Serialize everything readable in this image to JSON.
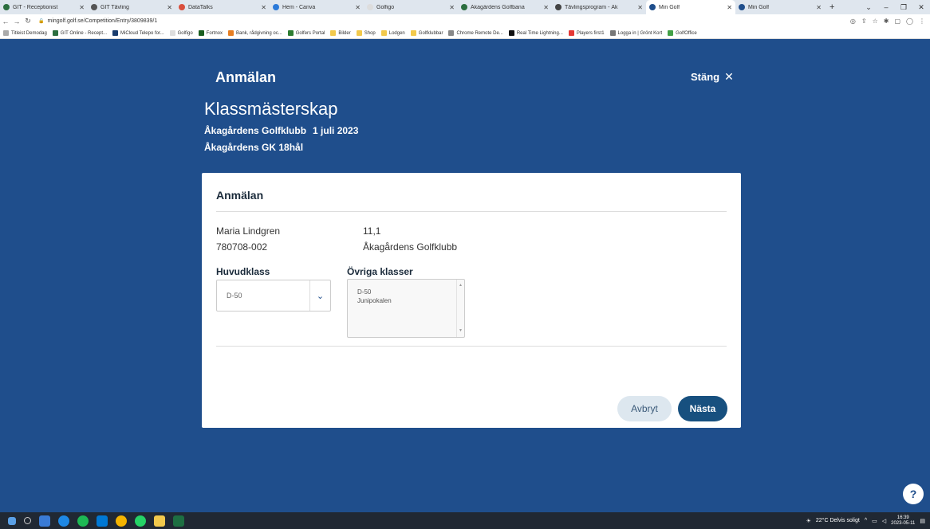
{
  "browser": {
    "tabs": [
      {
        "title": "GIT - Receptionist",
        "color": "#2c6e3f"
      },
      {
        "title": "GIT Tävling",
        "color": "#555555"
      },
      {
        "title": "DataTalks",
        "color": "#d94f3d"
      },
      {
        "title": "Hem - Canva",
        "color": "#2b7ad9"
      },
      {
        "title": "Golfigo",
        "color": "#dddddd"
      },
      {
        "title": "Åkagårdens Golfbana",
        "color": "#2c6e3f"
      },
      {
        "title": "Tävlingsprogram - Åk",
        "color": "#444444"
      },
      {
        "title": "Min Golf",
        "color": "#1f4e8c",
        "active": true
      },
      {
        "title": "Min Golf",
        "color": "#1f4e8c"
      }
    ],
    "new_tab": "+",
    "url": "mingolf.golf.se/Competition/Entry/3809839/1",
    "bookmarks": [
      {
        "label": "Titleist Demodag",
        "color": "#aaaaaa"
      },
      {
        "label": "GIT Online - Recept...",
        "color": "#2c6e3f"
      },
      {
        "label": "MiCloud Telepo for...",
        "color": "#1b3d6e"
      },
      {
        "label": "Golfigo",
        "color": "#dddddd"
      },
      {
        "label": "Fortnox",
        "color": "#1b5e20"
      },
      {
        "label": "Bank, rådgivning oc...",
        "color": "#e67e22"
      },
      {
        "label": "Golfers Portal",
        "color": "#2e7d32"
      },
      {
        "label": "Bilder",
        "color": "#f2c94c"
      },
      {
        "label": "Shop",
        "color": "#f2c94c"
      },
      {
        "label": "Lodgen",
        "color": "#f2c94c"
      },
      {
        "label": "Golfklubbar",
        "color": "#f2c94c"
      },
      {
        "label": "Chrome Remote De...",
        "color": "#888888"
      },
      {
        "label": "Real Time Lightning...",
        "color": "#111111"
      },
      {
        "label": "Players first1",
        "color": "#e53935"
      },
      {
        "label": "Logga in | Grönt Kort",
        "color": "#777777"
      },
      {
        "label": "GolfOffice",
        "color": "#43a047"
      }
    ]
  },
  "header": {
    "title": "Anmälan",
    "close_label": "Stäng"
  },
  "competition": {
    "name": "Klassmästerskap",
    "club": "Åkagårdens Golfklubb",
    "date": "1 juli 2023",
    "course": "Åkagårdens GK 18hål"
  },
  "card": {
    "title": "Anmälan",
    "player_name": "Maria Lindgren",
    "player_id": "780708-002",
    "handicap": "11,1",
    "player_club": "Åkagårdens Golfklubb",
    "main_class_label": "Huvudklass",
    "main_class_value": "D-50",
    "other_classes_label": "Övriga klasser",
    "other_classes": [
      "D-50",
      "Junipokalen"
    ],
    "cancel_label": "Avbryt",
    "next_label": "Nästa"
  },
  "help_label": "?",
  "taskbar": {
    "weather": "22°C Delvis soligt",
    "time": "16:39",
    "date": "2023-05-11"
  }
}
